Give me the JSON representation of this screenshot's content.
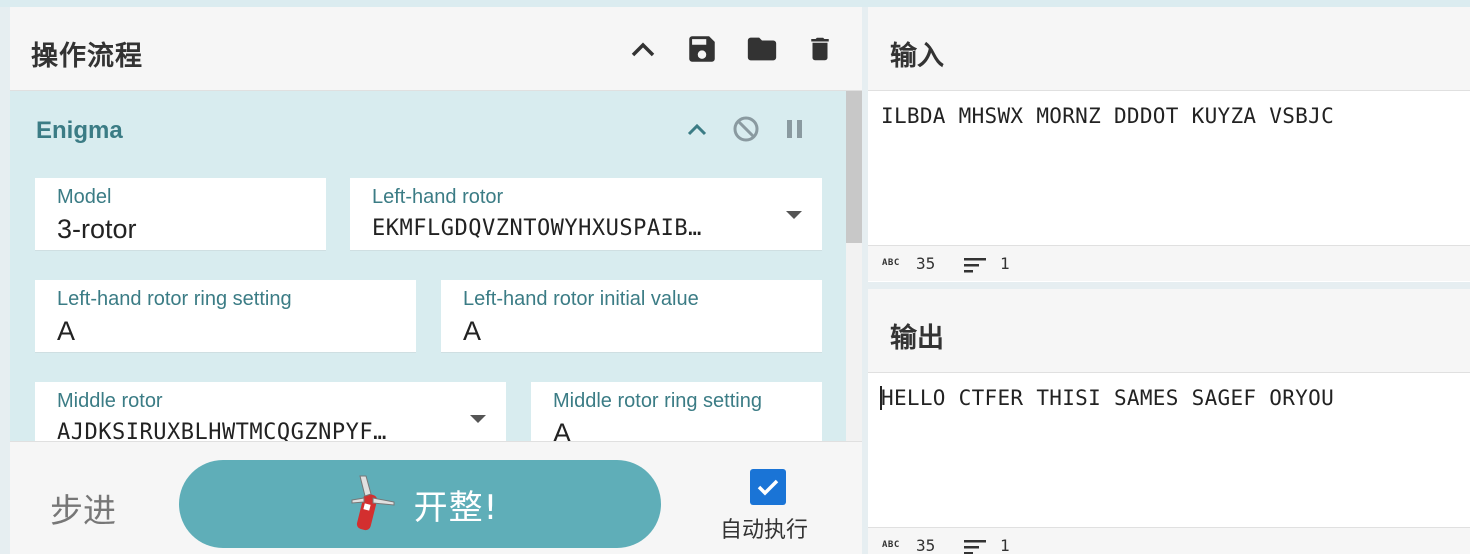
{
  "recipe": {
    "title": "操作流程",
    "header_icons": [
      "chevron-up-icon",
      "save-icon",
      "folder-icon",
      "trash-icon"
    ],
    "operation": {
      "name": "Enigma",
      "controls": [
        "chevron-up-icon",
        "disable-icon",
        "pause-icon"
      ],
      "fields": {
        "model": {
          "label": "Model",
          "value": "3-rotor"
        },
        "left_rotor": {
          "label": "Left-hand rotor",
          "value": "EKMFLGDQVZNTOWYHXUSPAIB…"
        },
        "left_ring": {
          "label": "Left-hand rotor ring setting",
          "value": "A"
        },
        "left_initial": {
          "label": "Left-hand rotor initial value",
          "value": "A"
        },
        "middle_rotor": {
          "label": "Middle rotor",
          "value": "AJDKSIRUXBLHWTMCQGZNPYF…"
        },
        "middle_ring": {
          "label": "Middle rotor ring setting",
          "value": "A"
        }
      }
    },
    "controls": {
      "step_label": "步进",
      "bake_label": "开整!",
      "auto_bake_label": "自动执行",
      "auto_bake_checked": true
    }
  },
  "input": {
    "title": "输入",
    "text": "ILBDA MHSWX MORNZ DDDOT KUYZA VSBJC",
    "status_abc": "ABC",
    "length": "35",
    "lines": "1"
  },
  "output": {
    "title": "输出",
    "text": "HELLO CTFER THISI SAMES SAGEF ORYOU",
    "status_abc": "ABC",
    "length": "35",
    "lines": "1"
  },
  "colors": {
    "operation_bg": "#d8ecef",
    "operation_title": "#3b7c85",
    "bake_button": "#5faeb8",
    "checkbox": "#1a74d6"
  }
}
